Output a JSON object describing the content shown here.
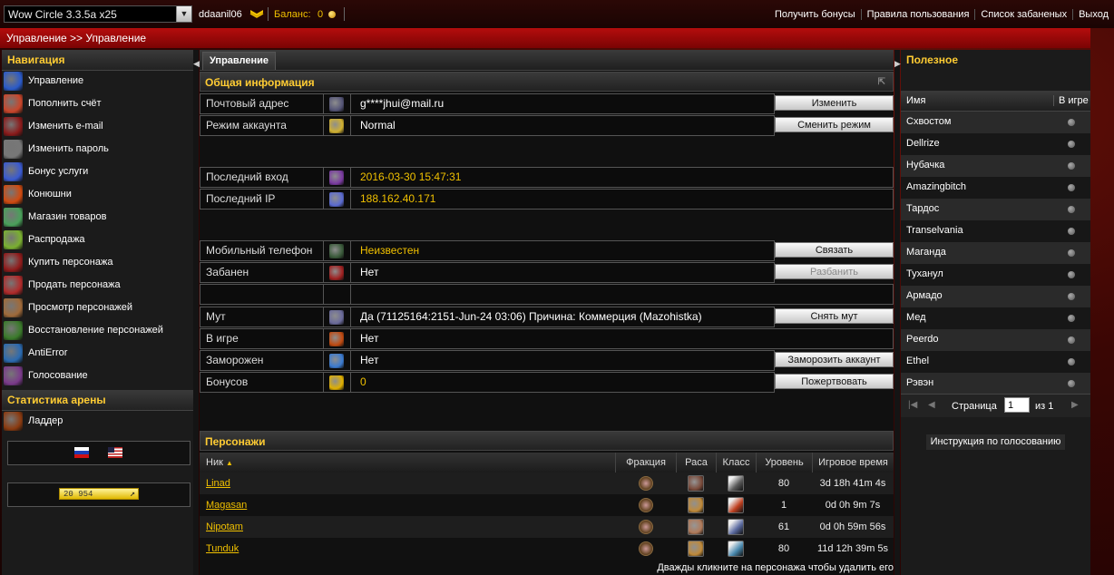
{
  "topbar": {
    "server": "Wow Circle 3.3.5a x25",
    "username": "ddaanil06",
    "balance_label": "Баланс:",
    "balance_value": "0",
    "links": [
      "Получить бонусы",
      "Правила пользования",
      "Список забаненых",
      "Выход"
    ]
  },
  "breadcrumb": "Управление >> Управление",
  "nav": {
    "title": "Навигация",
    "items": [
      {
        "label": "Управление",
        "icon": "management-icon",
        "color": "#2a5ac9"
      },
      {
        "label": "Пополнить счёт",
        "icon": "refill-icon",
        "color": "#c9452a"
      },
      {
        "label": "Изменить e-mail",
        "icon": "email-icon",
        "color": "#8a1a1a"
      },
      {
        "label": "Изменить пароль",
        "icon": "password-icon",
        "color": "#777777"
      },
      {
        "label": "Бонус услуги",
        "icon": "bonus-icon",
        "color": "#3a5ad0"
      },
      {
        "label": "Конюшни",
        "icon": "stable-icon",
        "color": "#d04a10"
      },
      {
        "label": "Магазин товаров",
        "icon": "shop-icon",
        "color": "#4aa05a"
      },
      {
        "label": "Распродажа",
        "icon": "sale-icon",
        "color": "#7ab030"
      },
      {
        "label": "Купить персонажа",
        "icon": "buy-character-icon",
        "color": "#901a1a"
      },
      {
        "label": "Продать персонажа",
        "icon": "sell-character-icon",
        "color": "#b02a2a"
      },
      {
        "label": "Просмотр персонажей",
        "icon": "view-characters-icon",
        "color": "#a06a3a"
      },
      {
        "label": "Восстановление персонажей",
        "icon": "restore-characters-icon",
        "color": "#3a7a2a"
      },
      {
        "label": "AntiError",
        "icon": "antierror-icon",
        "color": "#2a6ab0"
      },
      {
        "label": "Голосование",
        "icon": "voting-icon",
        "color": "#7a3a8a"
      }
    ],
    "arena_title": "Статистика арены",
    "arena_items": [
      {
        "label": "Ладдер",
        "icon": "ladder-icon",
        "color": "#8a3a10"
      }
    ],
    "counter": "20 954"
  },
  "main": {
    "tab": "Управление",
    "general_title": "Общая информация",
    "rows": [
      {
        "label": "Почтовый адрес",
        "value": "g****jhui@mail.ru",
        "icon": "mail-address-icon",
        "icon_color": "#555577",
        "value_color": "white",
        "button": "Изменить"
      },
      {
        "label": "Режим аккаунта",
        "value": "Normal",
        "icon": "star-icon",
        "icon_color": "#d0b030",
        "value_color": "white",
        "button": "Сменить режим"
      },
      {
        "label": "Последний вход",
        "value": "2016-03-30 15:47:31",
        "icon": "last-login-icon",
        "icon_color": "#7a3aa0",
        "value_color": "yellow"
      },
      {
        "label": "Последний IP",
        "value": "188.162.40.171",
        "icon": "last-ip-icon",
        "icon_color": "#5a6ad0",
        "value_color": "yellow"
      },
      {
        "label": "Мобильный телефон",
        "value": "Неизвестен",
        "icon": "phone-icon",
        "icon_color": "#3a5a3a",
        "value_color": "yellow",
        "button": "Связать"
      },
      {
        "label": "Забанен",
        "value": "Нет",
        "icon": "ban-icon",
        "icon_color": "#a02020",
        "value_color": "white",
        "button": "Разбанить",
        "button_disabled": true
      },
      {
        "label": "",
        "value": "",
        "icon": "",
        "icon_color": "",
        "value_color": "white"
      },
      {
        "label": "Мут",
        "value": "Да (71125164:2151-Jun-24 03:06) Причина: Коммерция (Mazohistka)",
        "icon": "mute-icon",
        "icon_color": "#6a6a9a",
        "value_color": "white",
        "button": "Снять мут"
      },
      {
        "label": "В игре",
        "value": "Нет",
        "icon": "in-game-icon",
        "icon_color": "#c04a10",
        "value_color": "white"
      },
      {
        "label": "Заморожен",
        "value": "Нет",
        "icon": "frozen-icon",
        "icon_color": "#3a7ad0",
        "value_color": "white",
        "button": "Заморозить аккаунт"
      },
      {
        "label": "Бонусов",
        "value": "0",
        "icon": "bonus-coin-icon",
        "icon_color": "#e0b000",
        "value_color": "yellow",
        "button": "Пожертвовать"
      }
    ],
    "characters_title": "Персонажи",
    "columns": [
      "Ник",
      "Фракция",
      "Раса",
      "Класс",
      "Уровень",
      "Игровое время"
    ],
    "characters": [
      {
        "nick": "Linad",
        "race_color": "#7a4a3a",
        "class_color": "#5a5a5a",
        "level": "80",
        "time": "3d 18h 41m 4s"
      },
      {
        "nick": "Magasan",
        "race_color": "#c08a3a",
        "class_color": "#c04020",
        "level": "1",
        "time": "0d 0h 9m 7s"
      },
      {
        "nick": "Nipotam",
        "race_color": "#b07a5a",
        "class_color": "#5a6aa0",
        "level": "61",
        "time": "0d 0h 59m 56s"
      },
      {
        "nick": "Tunduk",
        "race_color": "#c08a3a",
        "class_color": "#4a8ab0",
        "level": "80",
        "time": "11d 12h 39m 5s"
      }
    ],
    "hint": "Дважды кликните на персонажа чтобы удалить его"
  },
  "useful": {
    "title": "Полезное",
    "col_name": "Имя",
    "col_ingame": "В игре",
    "names": [
      "Схвостом",
      "Dellrize",
      "Нубачка",
      "Amazingbitch",
      "Тардос",
      "Transelvania",
      "Маганда",
      "Туханул",
      "Армадо",
      "Мед",
      "Peerdo",
      "Ethel",
      "Рэвэн"
    ],
    "page_label": "Страница",
    "page_value": "1",
    "page_of": "из 1",
    "vote_button": "Инструкция по голосованию"
  }
}
